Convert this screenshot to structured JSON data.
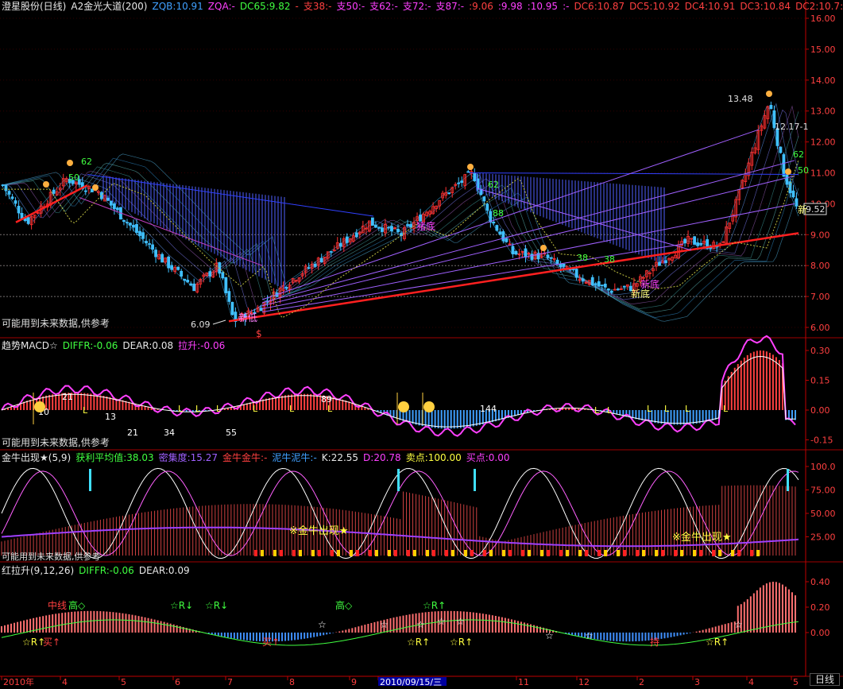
{
  "window": {
    "period_label": "日线"
  },
  "colors": {
    "bg": "#000000",
    "axis": "#c00000",
    "grid": "#500000",
    "up": "#ff3030",
    "down": "#40c0ff",
    "text": "#dddddd"
  },
  "panel1": {
    "header": [
      {
        "text": "澄星股份(日线)",
        "color": "#e8e8e8"
      },
      {
        "text": "A2金光大道(200)",
        "color": "#e8e8e8"
      },
      {
        "text": "ZQB:10.91",
        "color": "#40a0ff"
      },
      {
        "text": "ZQA:-",
        "color": "#ff40ff"
      },
      {
        "text": "DC65:9.82",
        "color": "#40ff40"
      },
      {
        "text": "-",
        "color": "#ff4040"
      },
      {
        "text": "支38:-",
        "color": "#ff4040"
      },
      {
        "text": "支50:-",
        "color": "#ff40ff"
      },
      {
        "text": "支62:-",
        "color": "#ff40ff"
      },
      {
        "text": "支72:-",
        "color": "#ff40ff"
      },
      {
        "text": "支87:-",
        "color": "#ff40ff"
      },
      {
        "text": ":9.06",
        "color": "#ff4040"
      },
      {
        "text": ":9.98",
        "color": "#ff40ff"
      },
      {
        "text": ":10.95",
        "color": "#ff40ff"
      },
      {
        "text": ":-",
        "color": "#ff40ff"
      },
      {
        "text": "DC6:10.87",
        "color": "#ff4040"
      },
      {
        "text": "DC5:10.92",
        "color": "#ff4040"
      },
      {
        "text": "DC4:10.91",
        "color": "#ff4040"
      },
      {
        "text": "DC3:10.84",
        "color": "#ff4040"
      },
      {
        "text": "DC2:10.7:",
        "color": "#ff4040"
      }
    ],
    "note": "可能用到未来数据,供参考",
    "annotations": {
      "low_price": "6.09",
      "high_price": "13.48",
      "high2": "12.17-1",
      "current": "9.52",
      "new_low_1": "新低",
      "new_low_2": "新底",
      "new_low_3": "新底",
      "label_zhudi_1": "猪底",
      "label_zhudi_2": "猪底",
      "s_mark": "$",
      "n62a": "62",
      "n50": "50",
      "n62b": "62",
      "n62c": "62",
      "n62d": "62",
      "n50b": "50",
      "n38a": "38",
      "n38b": "38",
      "n88": "88",
      "n10": "10",
      "xin": "新"
    }
  },
  "panel2": {
    "header": [
      {
        "text": "趋势MACD☆",
        "color": "#e8e8e8"
      },
      {
        "text": "DIFFR:-0.06",
        "color": "#40ff40"
      },
      {
        "text": "DEAR:0.08",
        "color": "#e8e8e8"
      },
      {
        "text": "拉升:-0.06",
        "color": "#ff40ff"
      }
    ],
    "note": "可能用到未来数据,供参考",
    "annotations": [
      "21",
      "10",
      "13",
      "21",
      "34",
      "55",
      "89",
      "144"
    ],
    "l_label": "L"
  },
  "panel3": {
    "header": [
      {
        "text": "金牛出现★(5,9)",
        "color": "#e8e8e8"
      },
      {
        "text": "获利平均值:38.03",
        "color": "#40ff40"
      },
      {
        "text": "密集度:15.27",
        "color": "#a060ff"
      },
      {
        "text": "金牛金牛:-",
        "color": "#ff4040"
      },
      {
        "text": "泥牛泥牛:-",
        "color": "#40a0ff"
      },
      {
        "text": "K:22.55",
        "color": "#e8e8e8"
      },
      {
        "text": "D:20.78",
        "color": "#ff40ff"
      },
      {
        "text": "卖点:100.00",
        "color": "#ffff40"
      },
      {
        "text": "买点:0.00",
        "color": "#ff40ff"
      }
    ],
    "gold_1": "※金牛出现★",
    "gold_2": "※金牛出现★",
    "note": "可能用到未来数据,供参考"
  },
  "panel4": {
    "header": [
      {
        "text": "红拉升(9,12,26)",
        "color": "#e8e8e8"
      },
      {
        "text": "DIFFR:-0.06",
        "color": "#40ff40"
      },
      {
        "text": "DEAR:0.09",
        "color": "#e8e8e8"
      }
    ],
    "labels": {
      "mid": "中线",
      "high": "高◇",
      "star_r_down": "☆R↓",
      "star_r_up": "☆R↑",
      "buy": "买↑",
      "star": "☆",
      "hold": "持"
    }
  },
  "axes": {
    "price_ticks": [
      "16.00",
      "15.00",
      "14.00",
      "13.00",
      "12.00",
      "11.00",
      "10.00",
      "9.00",
      "8.00",
      "7.00",
      "6.00"
    ],
    "macd_ticks": [
      "0.30",
      "0.15",
      "0.00",
      "-0.15"
    ],
    "kd_ticks": [
      "100.0",
      "75.00",
      "50.00",
      "25.00"
    ],
    "red_ticks": [
      "0.40",
      "0.20",
      "0.00"
    ],
    "dates": [
      "2010年",
      "4",
      "5",
      "6",
      "7",
      "8",
      "9",
      "2010/09/15/三",
      "11",
      "12",
      "2",
      "3",
      "4",
      "5"
    ]
  }
}
